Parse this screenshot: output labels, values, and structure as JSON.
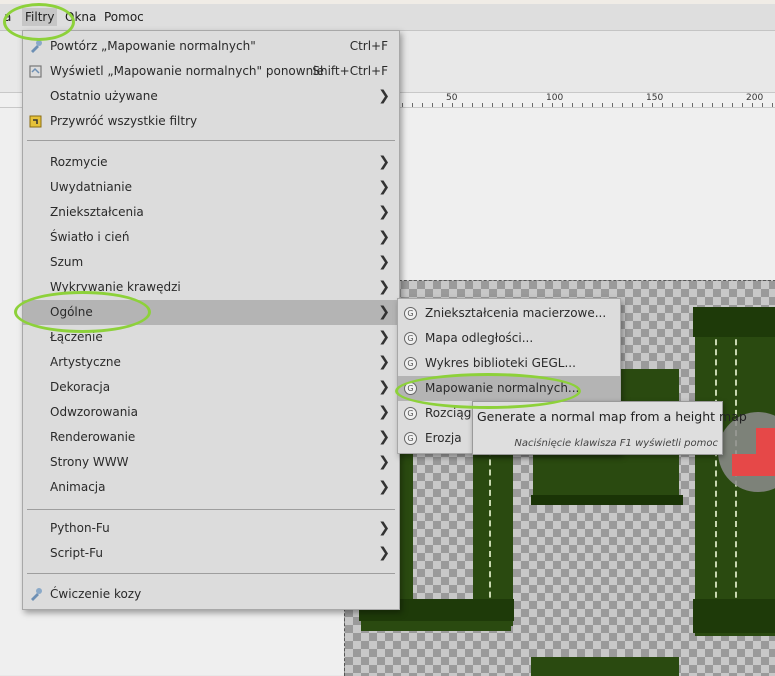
{
  "menubar": {
    "items": [
      {
        "label": "a",
        "active": false
      },
      {
        "label": "Filtry",
        "active": true
      },
      {
        "label": "Okna",
        "active": false
      },
      {
        "label": "Pomoc",
        "active": false
      }
    ]
  },
  "ruler": {
    "labels": [
      "50",
      "100",
      "150",
      "200"
    ]
  },
  "filters_menu": {
    "repeat": {
      "label": "Powtórz „Mapowanie normalnych\"",
      "shortcut": "Ctrl+F"
    },
    "reshow": {
      "label": "Wyświetl „Mapowanie normalnych\" ponownie",
      "shortcut": "Shift+Ctrl+F"
    },
    "recent": {
      "label": "Ostatnio używane"
    },
    "reset": {
      "label": "Przywróć wszystkie filtry"
    },
    "categories": [
      "Rozmycie",
      "Uwydatnianie",
      "Zniekształcenia",
      "Światło i cień",
      "Szum",
      "Wykrywanie krawędzi",
      "Ogólne",
      "Łączenie",
      "Artystyczne",
      "Dekoracja",
      "Odwzorowania",
      "Renderowanie",
      "Strony WWW",
      "Animacja"
    ],
    "scripting": [
      "Python-Fu",
      "Script-Fu"
    ],
    "goat": {
      "label": "Ćwiczenie kozy"
    }
  },
  "generic_submenu": {
    "items": [
      "Zniekształcenia macierzowe...",
      "Mapa odległości...",
      "Wykres biblioteki GEGL...",
      "Mapowanie normalnych...",
      "Rozciąga",
      "Erozja"
    ]
  },
  "tooltip": {
    "description": "Generate a normal map from a height map",
    "help_hint": "Naciśnięcie klawisza F1 wyświetli pomoc"
  },
  "colors": {
    "highlight_ring": "#8dd13a",
    "menu_bg": "#dcdcdc",
    "menu_hover": "#b4b4b4"
  }
}
